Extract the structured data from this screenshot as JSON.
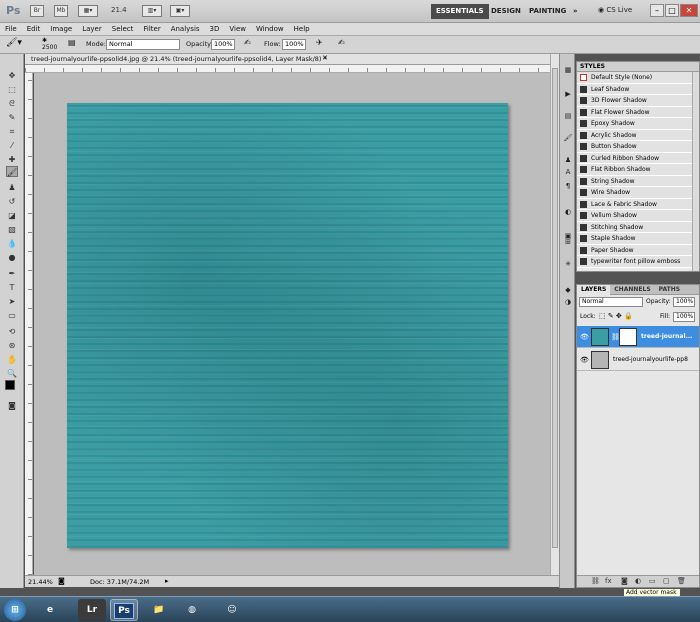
{
  "appbar": {
    "logo": "Ps",
    "zoom": "21.4",
    "workspaces": [
      "ESSENTIALS",
      "DESIGN",
      "PAINTING"
    ],
    "more": "»",
    "cslive": "CS Live"
  },
  "menu": [
    "File",
    "Edit",
    "Image",
    "Layer",
    "Select",
    "Filter",
    "Analysis",
    "3D",
    "View",
    "Window",
    "Help"
  ],
  "options": {
    "brush_size": "2500",
    "mode_label": "Mode:",
    "mode_value": "Normal",
    "opacity_label": "Opacity:",
    "opacity_value": "100%",
    "flow_label": "Flow:",
    "flow_value": "100%"
  },
  "document": {
    "tab_title": "treed-journalyourlife-ppsolid4.jpg @ 21.4% (treed-journalyourlife-ppsolid4, Layer Mask/8) *",
    "zoom_status": "21.44%",
    "doc_size": "Doc: 37.1M/74.2M"
  },
  "styles_panel": {
    "header": "STYLES",
    "items": [
      "Default Style (None)",
      "Leaf Shadow",
      "3D Flower Shadow",
      "Flat Flower Shadow",
      "Epoxy Shadow",
      "Acrylic Shadow",
      "Button Shadow",
      "Curled Ribbon Shadow",
      "Flat Ribbon Shadow",
      "String Shadow",
      "Wire Shadow",
      "Lace & Fabric Shadow",
      "Vellum Shadow",
      "Stitching Shadow",
      "Staple Shadow",
      "Paper Shadow",
      "typewriter font pillow emboss"
    ]
  },
  "layers_panel": {
    "tabs": [
      "LAYERS",
      "CHANNELS",
      "PATHS"
    ],
    "blend_mode": "Normal",
    "opacity_label": "Opacity:",
    "opacity_value": "100%",
    "lock_label": "Lock:",
    "fill_label": "Fill:",
    "fill_value": "100%",
    "layers": [
      {
        "name": "treed-journal...",
        "selected": true
      },
      {
        "name": "treed-journalyourlife-pp8",
        "selected": false
      }
    ],
    "tooltip": "Add vector mask"
  },
  "taskbar": {
    "lr_label": "Lr",
    "ps_label": "Ps"
  },
  "colors": {
    "canvas_teal": "#3c9ea5",
    "selection_blue": "#3d8ee0"
  }
}
